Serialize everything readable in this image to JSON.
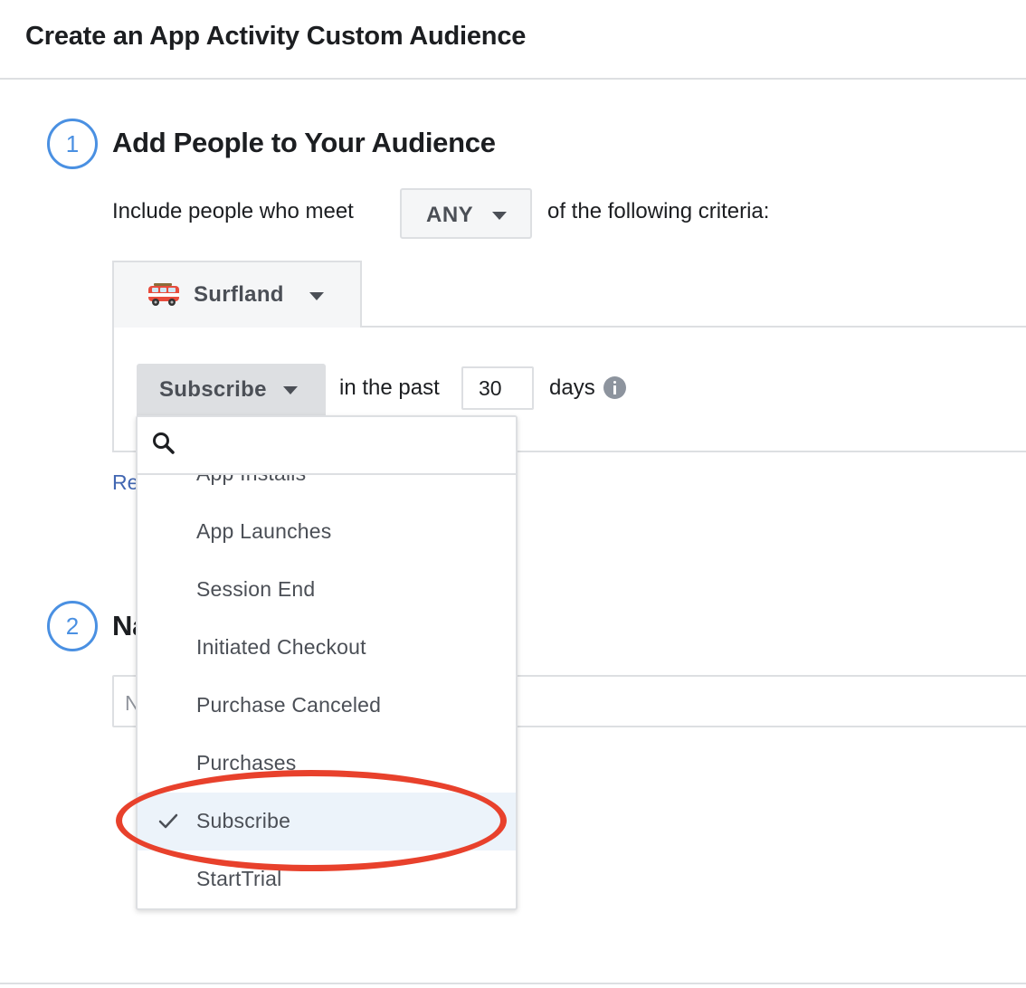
{
  "header": {
    "title": "Create an App Activity Custom Audience"
  },
  "step1": {
    "number": "1",
    "title": "Add People to Your Audience",
    "include_prefix": "Include people who meet",
    "match_value": "ANY",
    "include_suffix": "of the following criteria:"
  },
  "app": {
    "name": "Surfland",
    "icon": "van-icon"
  },
  "criteria": {
    "event_value": "Subscribe",
    "in_the_past": "in the past",
    "days_value": "30",
    "days_label": "days"
  },
  "partial_link": "Re",
  "step2": {
    "number": "2",
    "title_partial": "Na",
    "name_placeholder_partial": "N"
  },
  "dropdown": {
    "search_value": "",
    "items": [
      {
        "label": "App Installs",
        "selected": false
      },
      {
        "label": "App Launches",
        "selected": false
      },
      {
        "label": "Session End",
        "selected": false
      },
      {
        "label": "Initiated Checkout",
        "selected": false
      },
      {
        "label": "Purchase Canceled",
        "selected": false
      },
      {
        "label": "Purchases",
        "selected": false
      },
      {
        "label": "Subscribe",
        "selected": true
      },
      {
        "label": "StartTrial",
        "selected": false
      }
    ]
  },
  "colors": {
    "accent_blue": "#4a90e2",
    "link_blue": "#4267b2",
    "annotation_red": "#e8412c",
    "selected_row": "#ecf3fa"
  }
}
